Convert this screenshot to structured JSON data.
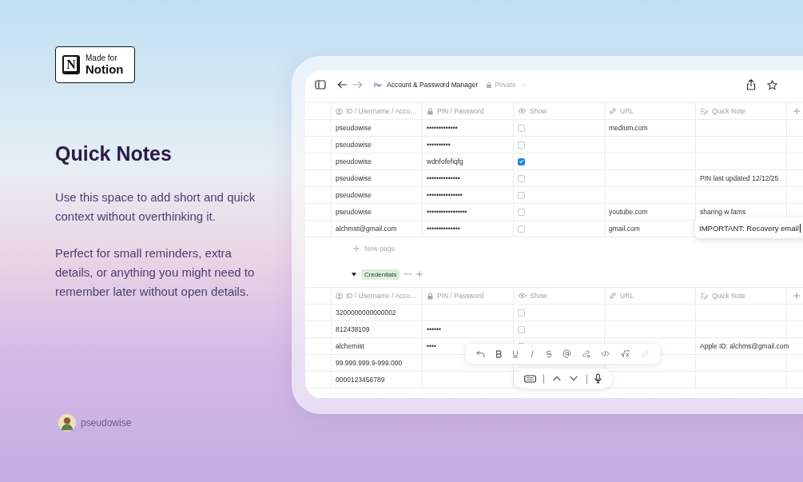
{
  "badge": {
    "logo_letter": "N",
    "line1": "Made for",
    "line2": "Notion"
  },
  "heading": "Quick Notes",
  "paragraphs": [
    "Use this space to add short and quick context without overthinking it.",
    "Perfect for small reminders, extra details, or anything you might need to remember later without open details."
  ],
  "author": {
    "name": "pseudowise"
  },
  "app": {
    "title": "Account & Password Manager",
    "privacy": "Private",
    "groups": [
      {
        "columns": [
          {
            "label": "ID / Username / Acco…",
            "kind": "person"
          },
          {
            "label": "PIN / Password",
            "kind": "lock"
          },
          {
            "label": "Show",
            "kind": "eye"
          },
          {
            "label": "URL",
            "kind": "link"
          },
          {
            "label": "Quick Note",
            "kind": "note"
          }
        ],
        "rows": [
          {
            "id": "pseudowise",
            "pin": "•••••••••••••",
            "show": false,
            "url": "medium.com",
            "note": "",
            "editing": false
          },
          {
            "id": "pseudowise",
            "pin": "••••••••••",
            "show": false,
            "url": "",
            "note": "",
            "editing": false
          },
          {
            "id": "pseudowise",
            "pin": "wdnfofefiqfg",
            "show": true,
            "url": "",
            "note": "",
            "editing": false
          },
          {
            "id": "pseudowise",
            "pin": "••••••••••••••",
            "show": false,
            "url": "",
            "note": "PIN last updated 12/12/25",
            "editing": false
          },
          {
            "id": "pseudowise",
            "pin": "•••••••••••••••",
            "show": false,
            "url": "",
            "note": "",
            "editing": false
          },
          {
            "id": "pseudowise",
            "pin": "•••••••••••••••••",
            "show": false,
            "url": "youtube.com",
            "note": "sharing w fams",
            "editing": false
          },
          {
            "id": "alchmst@gmail.com",
            "pin": "••••••••••••••",
            "show": false,
            "url": "gmail.com",
            "note": "IMPORTANT: Recovery email",
            "editing": true
          }
        ],
        "new_page": "New page"
      },
      {
        "name": "Credentials",
        "columns": [
          {
            "label": "ID / Username / Acco…",
            "kind": "person"
          },
          {
            "label": "PIN / Password",
            "kind": "lock"
          },
          {
            "label": "Show",
            "kind": "eye"
          },
          {
            "label": "URL",
            "kind": "link"
          },
          {
            "label": "Quick Note",
            "kind": "note"
          }
        ],
        "rows": [
          {
            "id": "3200000000000002",
            "pin": "",
            "show": false,
            "url": "",
            "note": "",
            "editing": false
          },
          {
            "id": "812438109",
            "pin": "••••••",
            "show": false,
            "url": "",
            "note": "",
            "editing": false
          },
          {
            "id": "alchemist",
            "pin": "••••",
            "show": false,
            "url": "",
            "note": "Apple ID: alchms@gmail.com",
            "editing": false
          },
          {
            "id": "99.999.999.9-999.000",
            "pin": "",
            "url": "",
            "note": "",
            "editing": false
          },
          {
            "id": "0000123456789",
            "pin": "",
            "url": "",
            "note": "",
            "editing": false
          }
        ]
      }
    ]
  }
}
